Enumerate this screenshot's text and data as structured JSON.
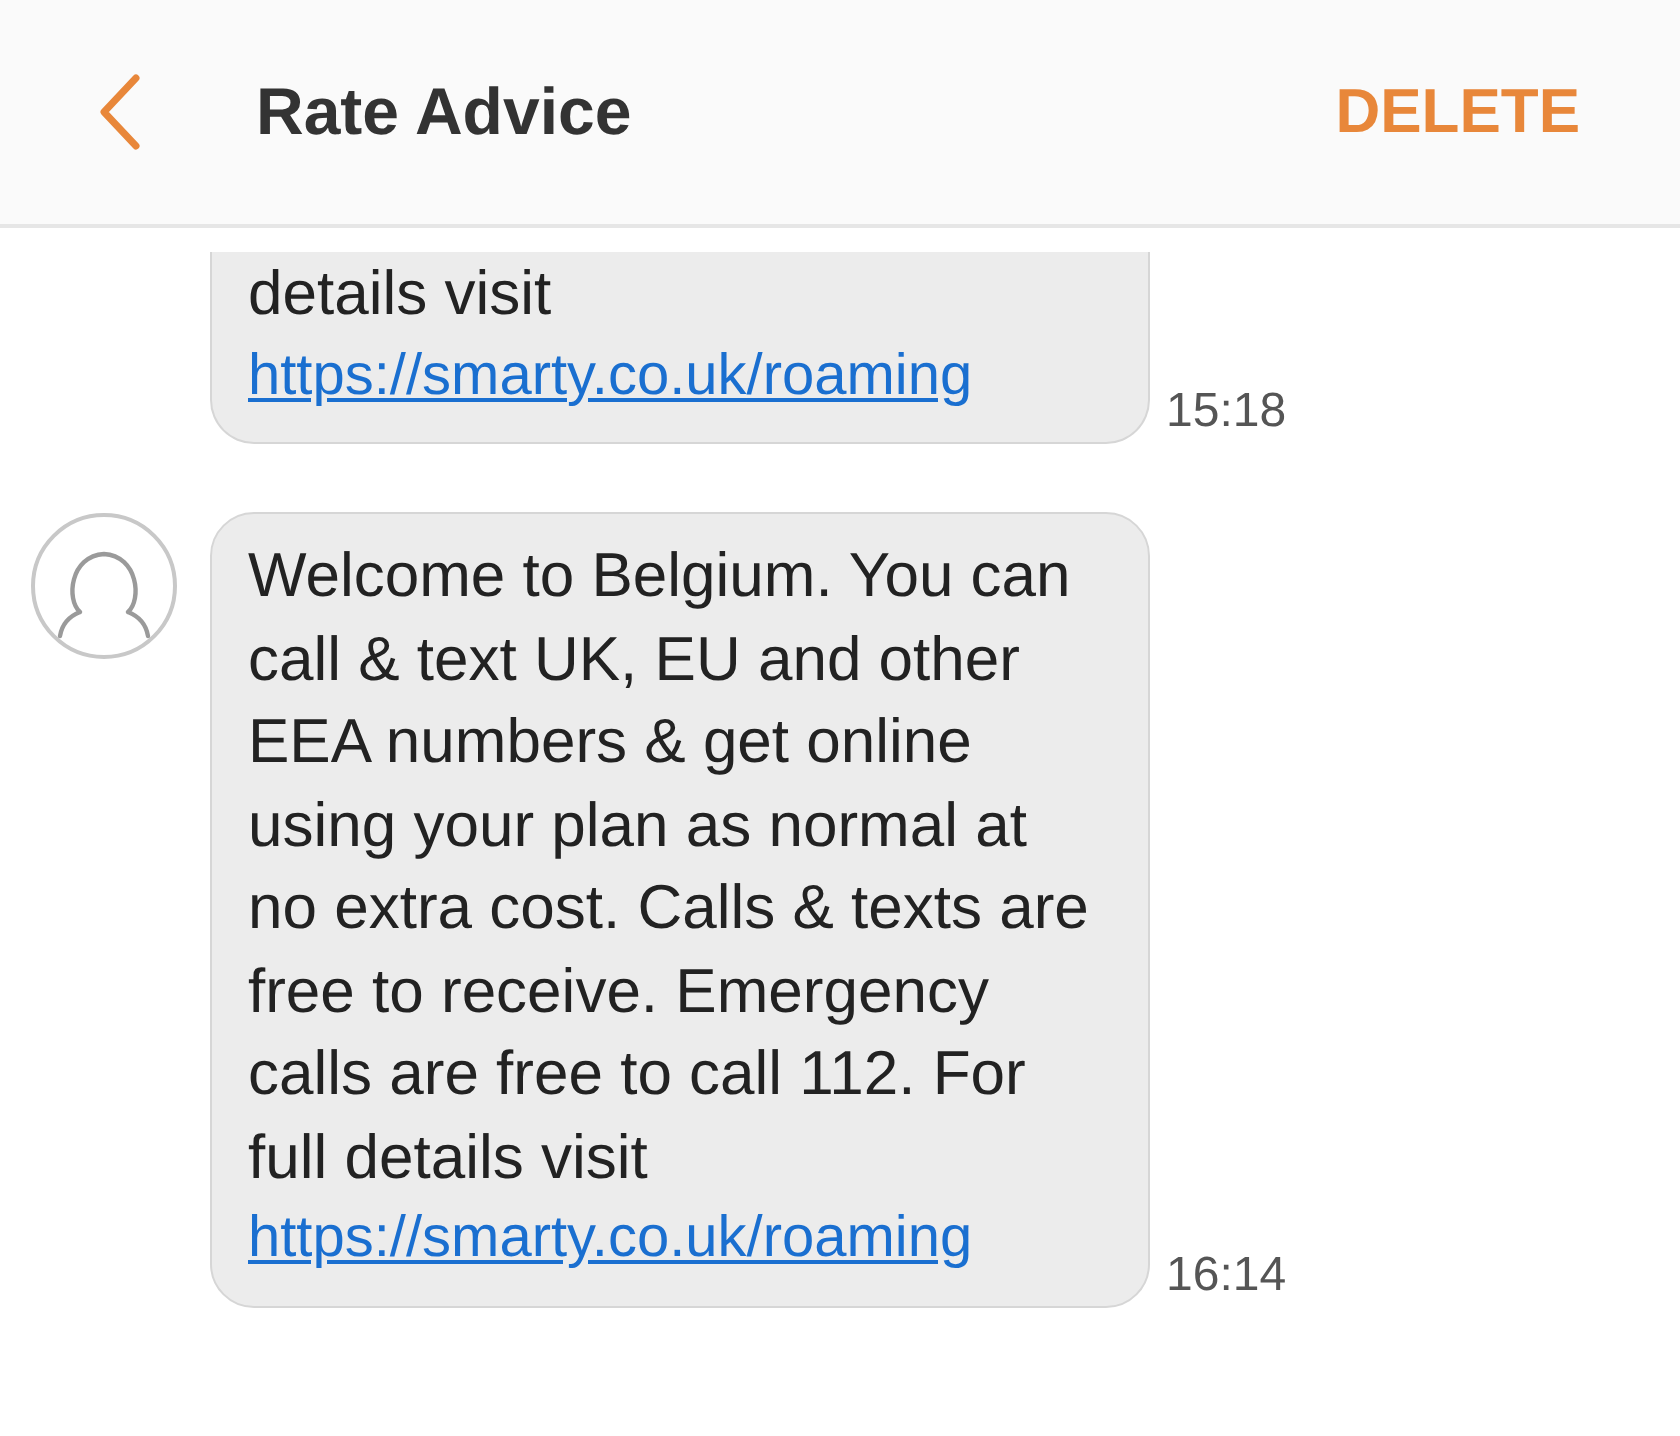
{
  "header": {
    "title": "Rate Advice",
    "action": "DELETE"
  },
  "messages": [
    {
      "text": "details visit ",
      "link": "https://smarty.co.uk/roaming",
      "time": "15:18",
      "show_avatar": false
    },
    {
      "text": "Welcome to Belgium. You can call & text UK, EU and other EEA numbers & get online using your plan as normal at no extra cost. Calls & texts are free to receive. Emergency calls are free to call 112. For full details visit ",
      "link": "https://smarty.co.uk/roaming",
      "time": "16:14",
      "show_avatar": true
    }
  ]
}
